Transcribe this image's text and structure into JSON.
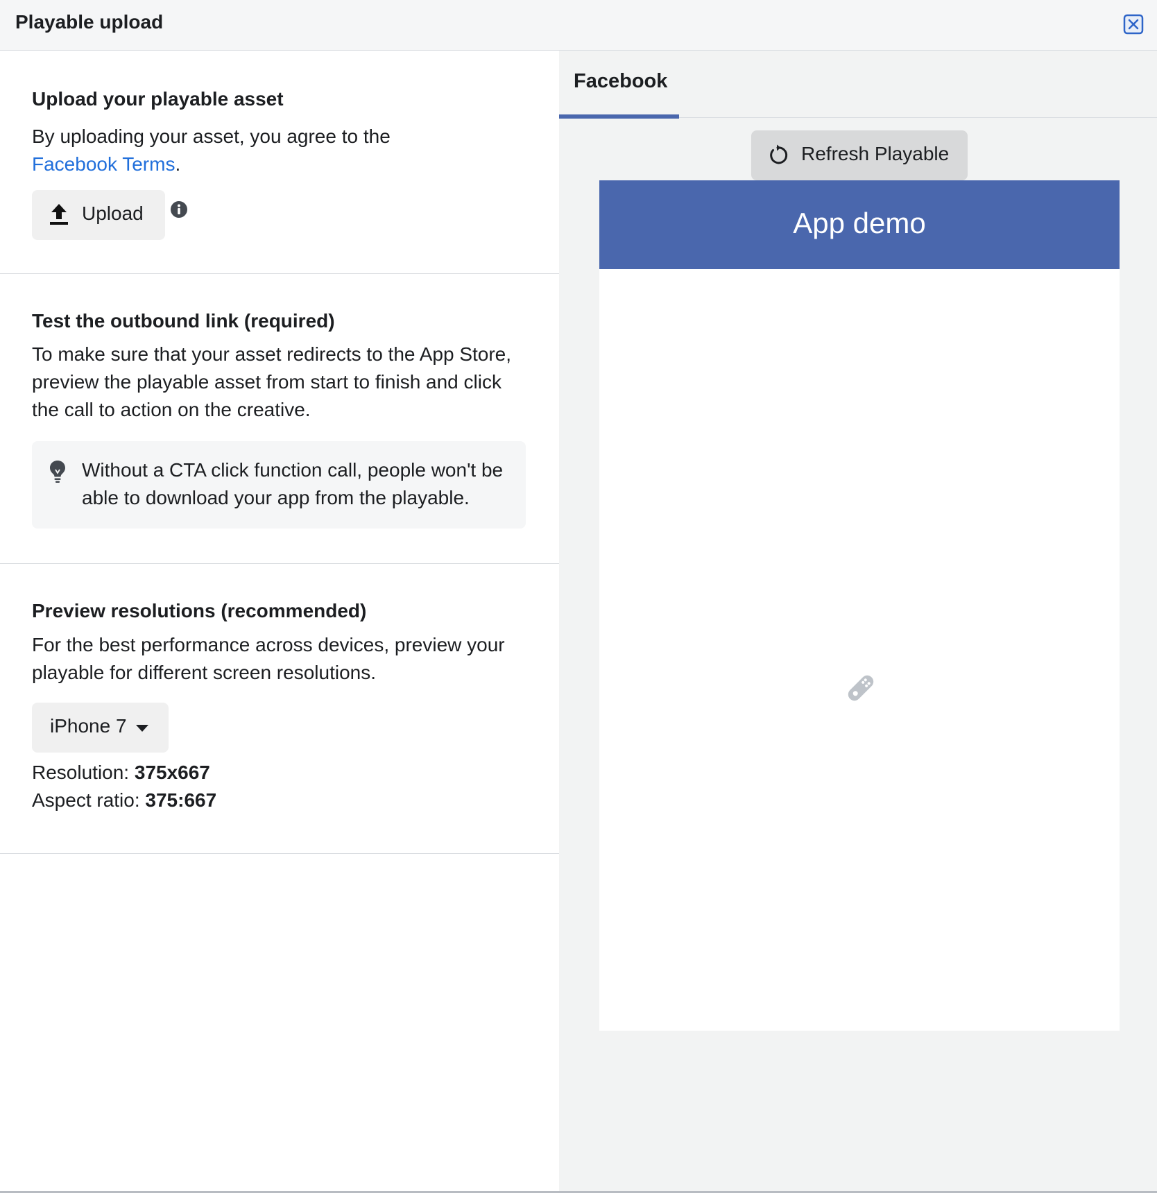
{
  "header": {
    "title": "Playable upload"
  },
  "upload_section": {
    "title": "Upload your playable asset",
    "text": "By uploading your asset, you agree to the",
    "terms_link": "Facebook Terms",
    "period": ".",
    "upload_label": "Upload"
  },
  "outbound_section": {
    "title": "Test the outbound link (required)",
    "lines": [
      "To make sure that your asset redirects to the App Store,",
      "preview the playable asset from start to finish and click",
      "the call to action on the creative."
    ],
    "tip_lines": [
      "Without a CTA click function call, people won't be",
      "able to download your app from the playable."
    ]
  },
  "preview_section": {
    "title": "Preview resolutions (recommended)",
    "lines": [
      "For the best performance across devices, preview your",
      "playable for different screen resolutions."
    ],
    "device_select": "iPhone 7",
    "resolution_label": "Resolution: ",
    "resolution_value": "375x667",
    "aspect_label": "Aspect ratio: ",
    "aspect_value": "375:667"
  },
  "preview_panel": {
    "tab": "Facebook",
    "refresh_label": "Refresh Playable",
    "app_title": "App demo"
  },
  "colors": {
    "accent": "#4a67ad",
    "link": "#216fdb",
    "panel_bg": "#f2f3f3"
  },
  "icons": [
    "close-icon",
    "upload-icon",
    "info-icon",
    "lightbulb-icon",
    "chevron-down-icon",
    "refresh-icon",
    "gamepad-icon"
  ]
}
